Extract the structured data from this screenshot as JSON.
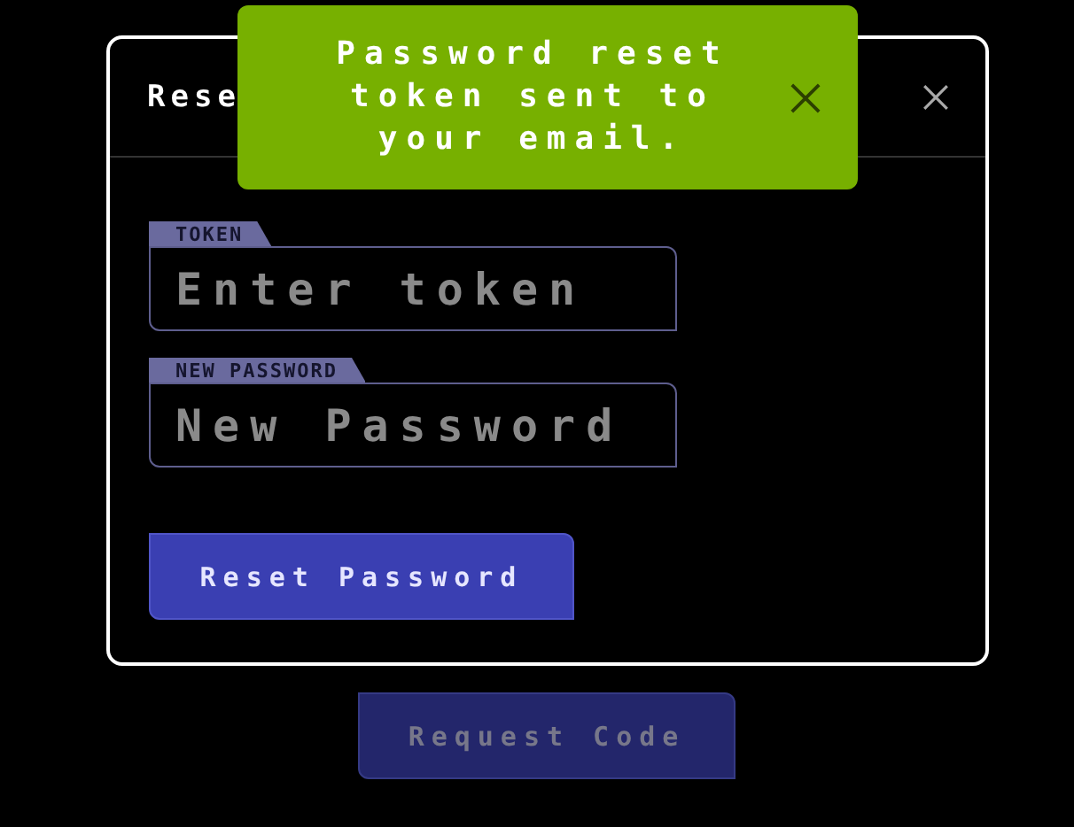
{
  "dialog": {
    "title": "Rese",
    "fields": [
      {
        "label": "TOKEN",
        "placeholder": "Enter token"
      },
      {
        "label": "NEW PASSWORD",
        "placeholder": "New Password"
      }
    ],
    "submit_button": "Reset Password"
  },
  "request_button": {
    "label": "Request Code",
    "disabled": true
  },
  "toast": {
    "message": "Password reset token sent to your email."
  }
}
